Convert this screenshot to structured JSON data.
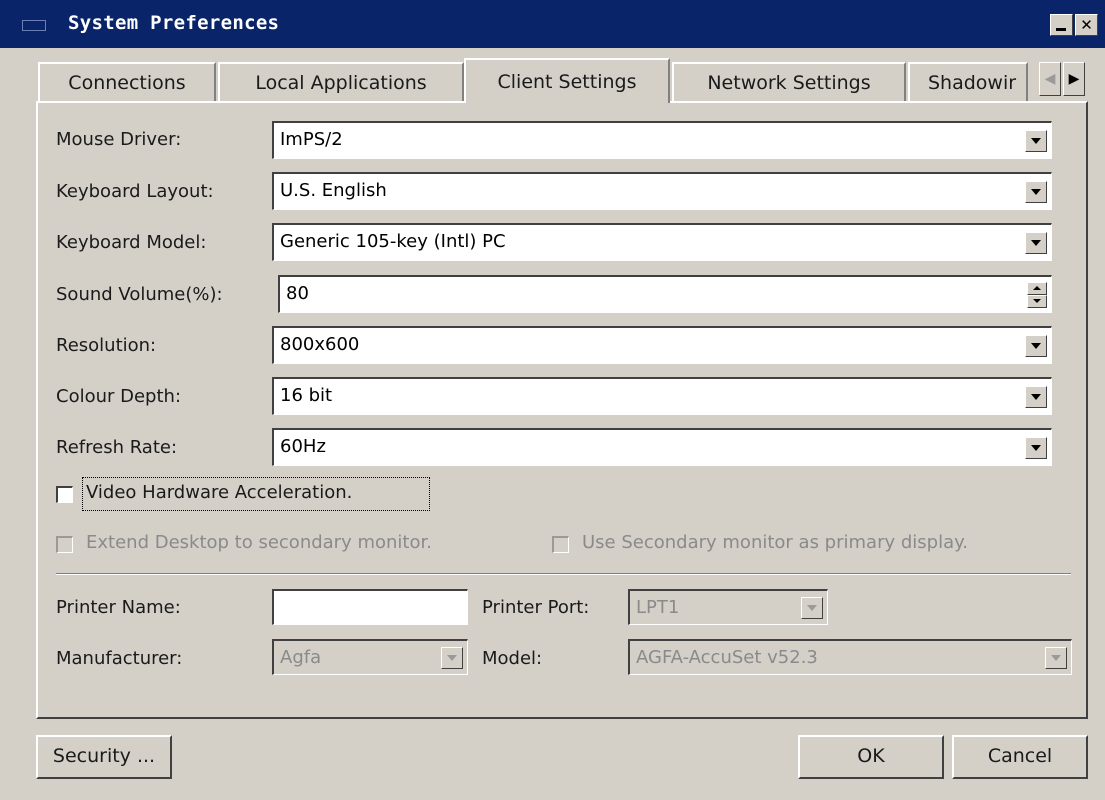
{
  "window": {
    "title": "System Preferences"
  },
  "tabs": [
    {
      "label": "Connections"
    },
    {
      "label": "Local Applications"
    },
    {
      "label": "Client Settings",
      "active": true
    },
    {
      "label": "Network Settings"
    },
    {
      "label": "Shadowir"
    }
  ],
  "client_settings": {
    "mouse_driver": {
      "label": "Mouse Driver:",
      "value": "ImPS/2"
    },
    "keyboard_layout": {
      "label": "Keyboard Layout:",
      "value": "U.S. English"
    },
    "keyboard_model": {
      "label": "Keyboard Model:",
      "value": "Generic 105-key (Intl) PC"
    },
    "sound_volume": {
      "label": "Sound Volume(%):",
      "value": "80"
    },
    "resolution": {
      "label": "Resolution:",
      "value": "800x600"
    },
    "colour_depth": {
      "label": "Colour Depth:",
      "value": "16 bit"
    },
    "refresh_rate": {
      "label": "Refresh Rate:",
      "value": "60Hz"
    },
    "video_hw_accel": {
      "label": "Video Hardware Acceleration.",
      "checked": false
    },
    "extend_desktop": {
      "label": "Extend Desktop to secondary monitor.",
      "checked": false,
      "enabled": false
    },
    "secondary_primary": {
      "label": "Use Secondary monitor as primary display.",
      "checked": false,
      "enabled": false
    }
  },
  "printer": {
    "name_label": "Printer Name:",
    "name_value": "",
    "port_label": "Printer Port:",
    "port_value": "LPT1",
    "manufacturer_label": "Manufacturer:",
    "manufacturer_value": "Agfa",
    "model_label": "Model:",
    "model_value": "AGFA-AccuSet v52.3"
  },
  "buttons": {
    "security": "Security ...",
    "ok": "OK",
    "cancel": "Cancel"
  },
  "colors": {
    "titlebar": "#0a246a",
    "face": "#d4d0c8",
    "disabled_text": "#8a8a8a"
  }
}
